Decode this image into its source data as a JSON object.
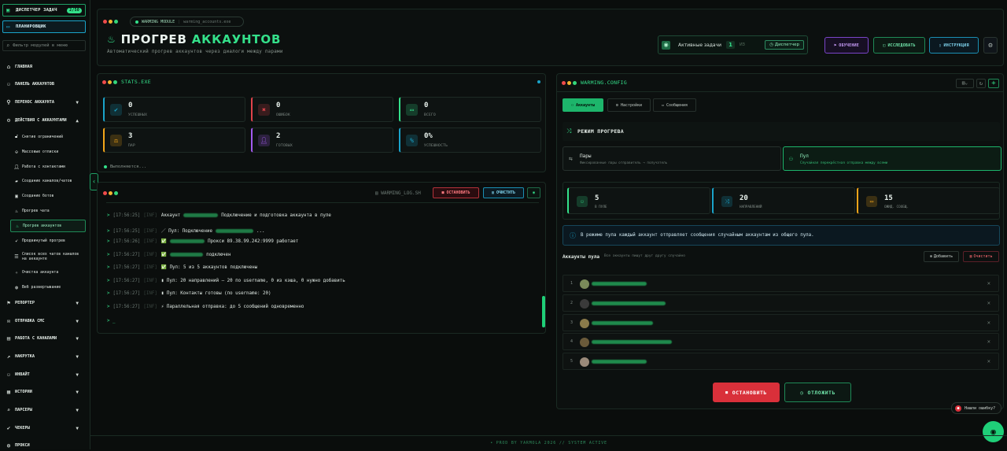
{
  "sidebar": {
    "task_dispatcher": {
      "label": "ДИСПЕТЧЕР ЗАДАЧ",
      "badge": "2/50"
    },
    "planner": "ПЛАНИРОВЩИК",
    "filter_placeholder": "Фильтр модулей в меню",
    "items": [
      {
        "label": "ГЛАВНАЯ"
      },
      {
        "label": "ПАНЕЛЬ АККАУНТОВ"
      },
      {
        "label": "ПЕРЕНОС АККАУНТА"
      },
      {
        "label": "ДЕЙСТВИЯ С АККАУНТАМИ"
      }
    ],
    "subitems": [
      {
        "label": "Снятие ограничений"
      },
      {
        "label": "Массовые отписки"
      },
      {
        "label": "Работа с контактами"
      },
      {
        "label": "Создание каналов/чатов"
      },
      {
        "label": "Создание ботов"
      },
      {
        "label": "Прогрев чата"
      },
      {
        "label": "Прогрев аккаунтов"
      },
      {
        "label": "Продвинутый прогрев"
      },
      {
        "label": "Список всех чатов каналов на аккаунте"
      },
      {
        "label": "Очистка аккаунта"
      },
      {
        "label": "Веб развертывание"
      }
    ],
    "bottom_items": [
      {
        "label": "РЕПОРТЕР"
      },
      {
        "label": "ОТПРАВКА СМС"
      },
      {
        "label": "РАБОТА С КАНАЛАМИ"
      },
      {
        "label": "НАКРУТКА"
      },
      {
        "label": "ИНВАЙТ"
      },
      {
        "label": "ИСТОРИИ"
      },
      {
        "label": "ПАРСЕРЫ"
      },
      {
        "label": "ЧЕКЕРЫ"
      },
      {
        "label": "ПРОКСИ"
      }
    ]
  },
  "header": {
    "module_tag": "WARMING MODULE",
    "file_tag": "warming_accounts.exe",
    "title_a": "ПРОГРЕВ",
    "title_b": "АККАУНТОВ",
    "subtitle": "Автоматический прогрев аккаунтов через диалоги между парами",
    "active_tasks_label": "Активные задачи",
    "active_tasks_count": "1",
    "active_tasks_max": "ИЗ",
    "dispatcher_btn": "Диспетчер",
    "btn_learning": "ОБУЧЕНИЕ",
    "btn_research": "ИССЛЕДОВАТЬ",
    "btn_instruction": "ИНСТРУКЦИЯ"
  },
  "stats": {
    "window_title": "STATS.EXE",
    "cards": [
      {
        "value": "0",
        "label": "УСПЕШНЫХ",
        "color": "#1aa3c9"
      },
      {
        "value": "0",
        "label": "ОШИБОК",
        "color": "#e0434b"
      },
      {
        "value": "0",
        "label": "ВСЕГО",
        "color": "#34e08a"
      },
      {
        "value": "3",
        "label": "ПАР",
        "color": "#f2a51a"
      },
      {
        "value": "2",
        "label": "ГОТОВЫХ",
        "color": "#a35bf0"
      },
      {
        "value": "0%",
        "label": "УСПЕШНОСТЬ",
        "color": "#1aa3c9"
      }
    ],
    "running": "Выполняется..."
  },
  "log": {
    "filename": "WARMING_LOG.SH",
    "stop_btn": "ОСТАНОВИТЬ",
    "clear_btn": "ОЧИСТИТЬ",
    "lines": [
      {
        "ts": "[17:56:25]",
        "lv": "[INF]",
        "pre": "Аккаунт",
        "blur": 44,
        "text": "Подключение и подготовка аккаунта в пуле"
      },
      {
        "ts": "[17:56:25]",
        "lv": "[INF]",
        "pre": "／ Пул: Подключение",
        "blur": 48,
        "text": "..."
      },
      {
        "ts": "[17:56:26]",
        "lv": "[INF]",
        "pre": "✅",
        "blur": 44,
        "text": "Прокси 89.38.99.242:9999 работает"
      },
      {
        "ts": "[17:56:27]",
        "lv": "[INF]",
        "pre": "✅",
        "blur": 42,
        "text": "подключен"
      },
      {
        "ts": "[17:56:27]",
        "lv": "[INF]",
        "pre": "",
        "blur": 0,
        "text": "✅ Пул: 5 из 5 аккаунтов подключены"
      },
      {
        "ts": "[17:56:27]",
        "lv": "[INF]",
        "pre": "",
        "blur": 0,
        "text": "▮ Пул: 20 направлений — 20 по username, 0 из кэша, 0 нужно добавить"
      },
      {
        "ts": "[17:56:27]",
        "lv": "[INF]",
        "pre": "",
        "blur": 0,
        "text": "▮ Пул: Контакты готовы (по username: 20)"
      },
      {
        "ts": "[17:56:27]",
        "lv": "[INF]",
        "pre": "",
        "blur": 0,
        "text": "⚡ Параллельная отправка: до 5 сообщений одновременно"
      }
    ],
    "prompt": "> _"
  },
  "config": {
    "window_title": "WARMING.CONFIG",
    "tabs": [
      "Аккаунты",
      "Настройки",
      "Сообщения"
    ],
    "mode_title": "РЕЖИМ ПРОГРЕВА",
    "modes": [
      {
        "title": "Пары",
        "desc": "Фиксированные пары отправитель → получатель"
      },
      {
        "title": "Пул",
        "desc": "Случайная перекрёстная отправка между всеми"
      }
    ],
    "pool_cards": [
      {
        "value": "5",
        "label": "В ПУЛЕ",
        "color": "#34e08a"
      },
      {
        "value": "20",
        "label": "НАПРАВЛЕНИЙ",
        "color": "#1aa3c9"
      },
      {
        "value": "15",
        "label": "ОЖИД. СООБЩ.",
        "color": "#f2a51a"
      }
    ],
    "info": "В режиме пула каждый аккаунт отправляет сообщения случайным аккаунтам из общего пула.",
    "accounts_title": "Аккаунты пула",
    "accounts_hint": "Все аккаунты пишут друг другу случайно",
    "add_btn": "Добавить",
    "clear_btn": "Очистить",
    "accounts": [
      {
        "n": "1",
        "w": 70
      },
      {
        "n": "2",
        "w": 94
      },
      {
        "n": "3",
        "w": 78
      },
      {
        "n": "4",
        "w": 102
      },
      {
        "n": "5",
        "w": 70
      }
    ],
    "stop_btn": "ОСТАНОВИТЬ",
    "postpone_btn": "ОТЛОЖИТЬ"
  },
  "bug_btn": "Нашли ошибку?",
  "footer": "• PROD BY YARMOLA 2026   // SYSTEM ACTIVE"
}
